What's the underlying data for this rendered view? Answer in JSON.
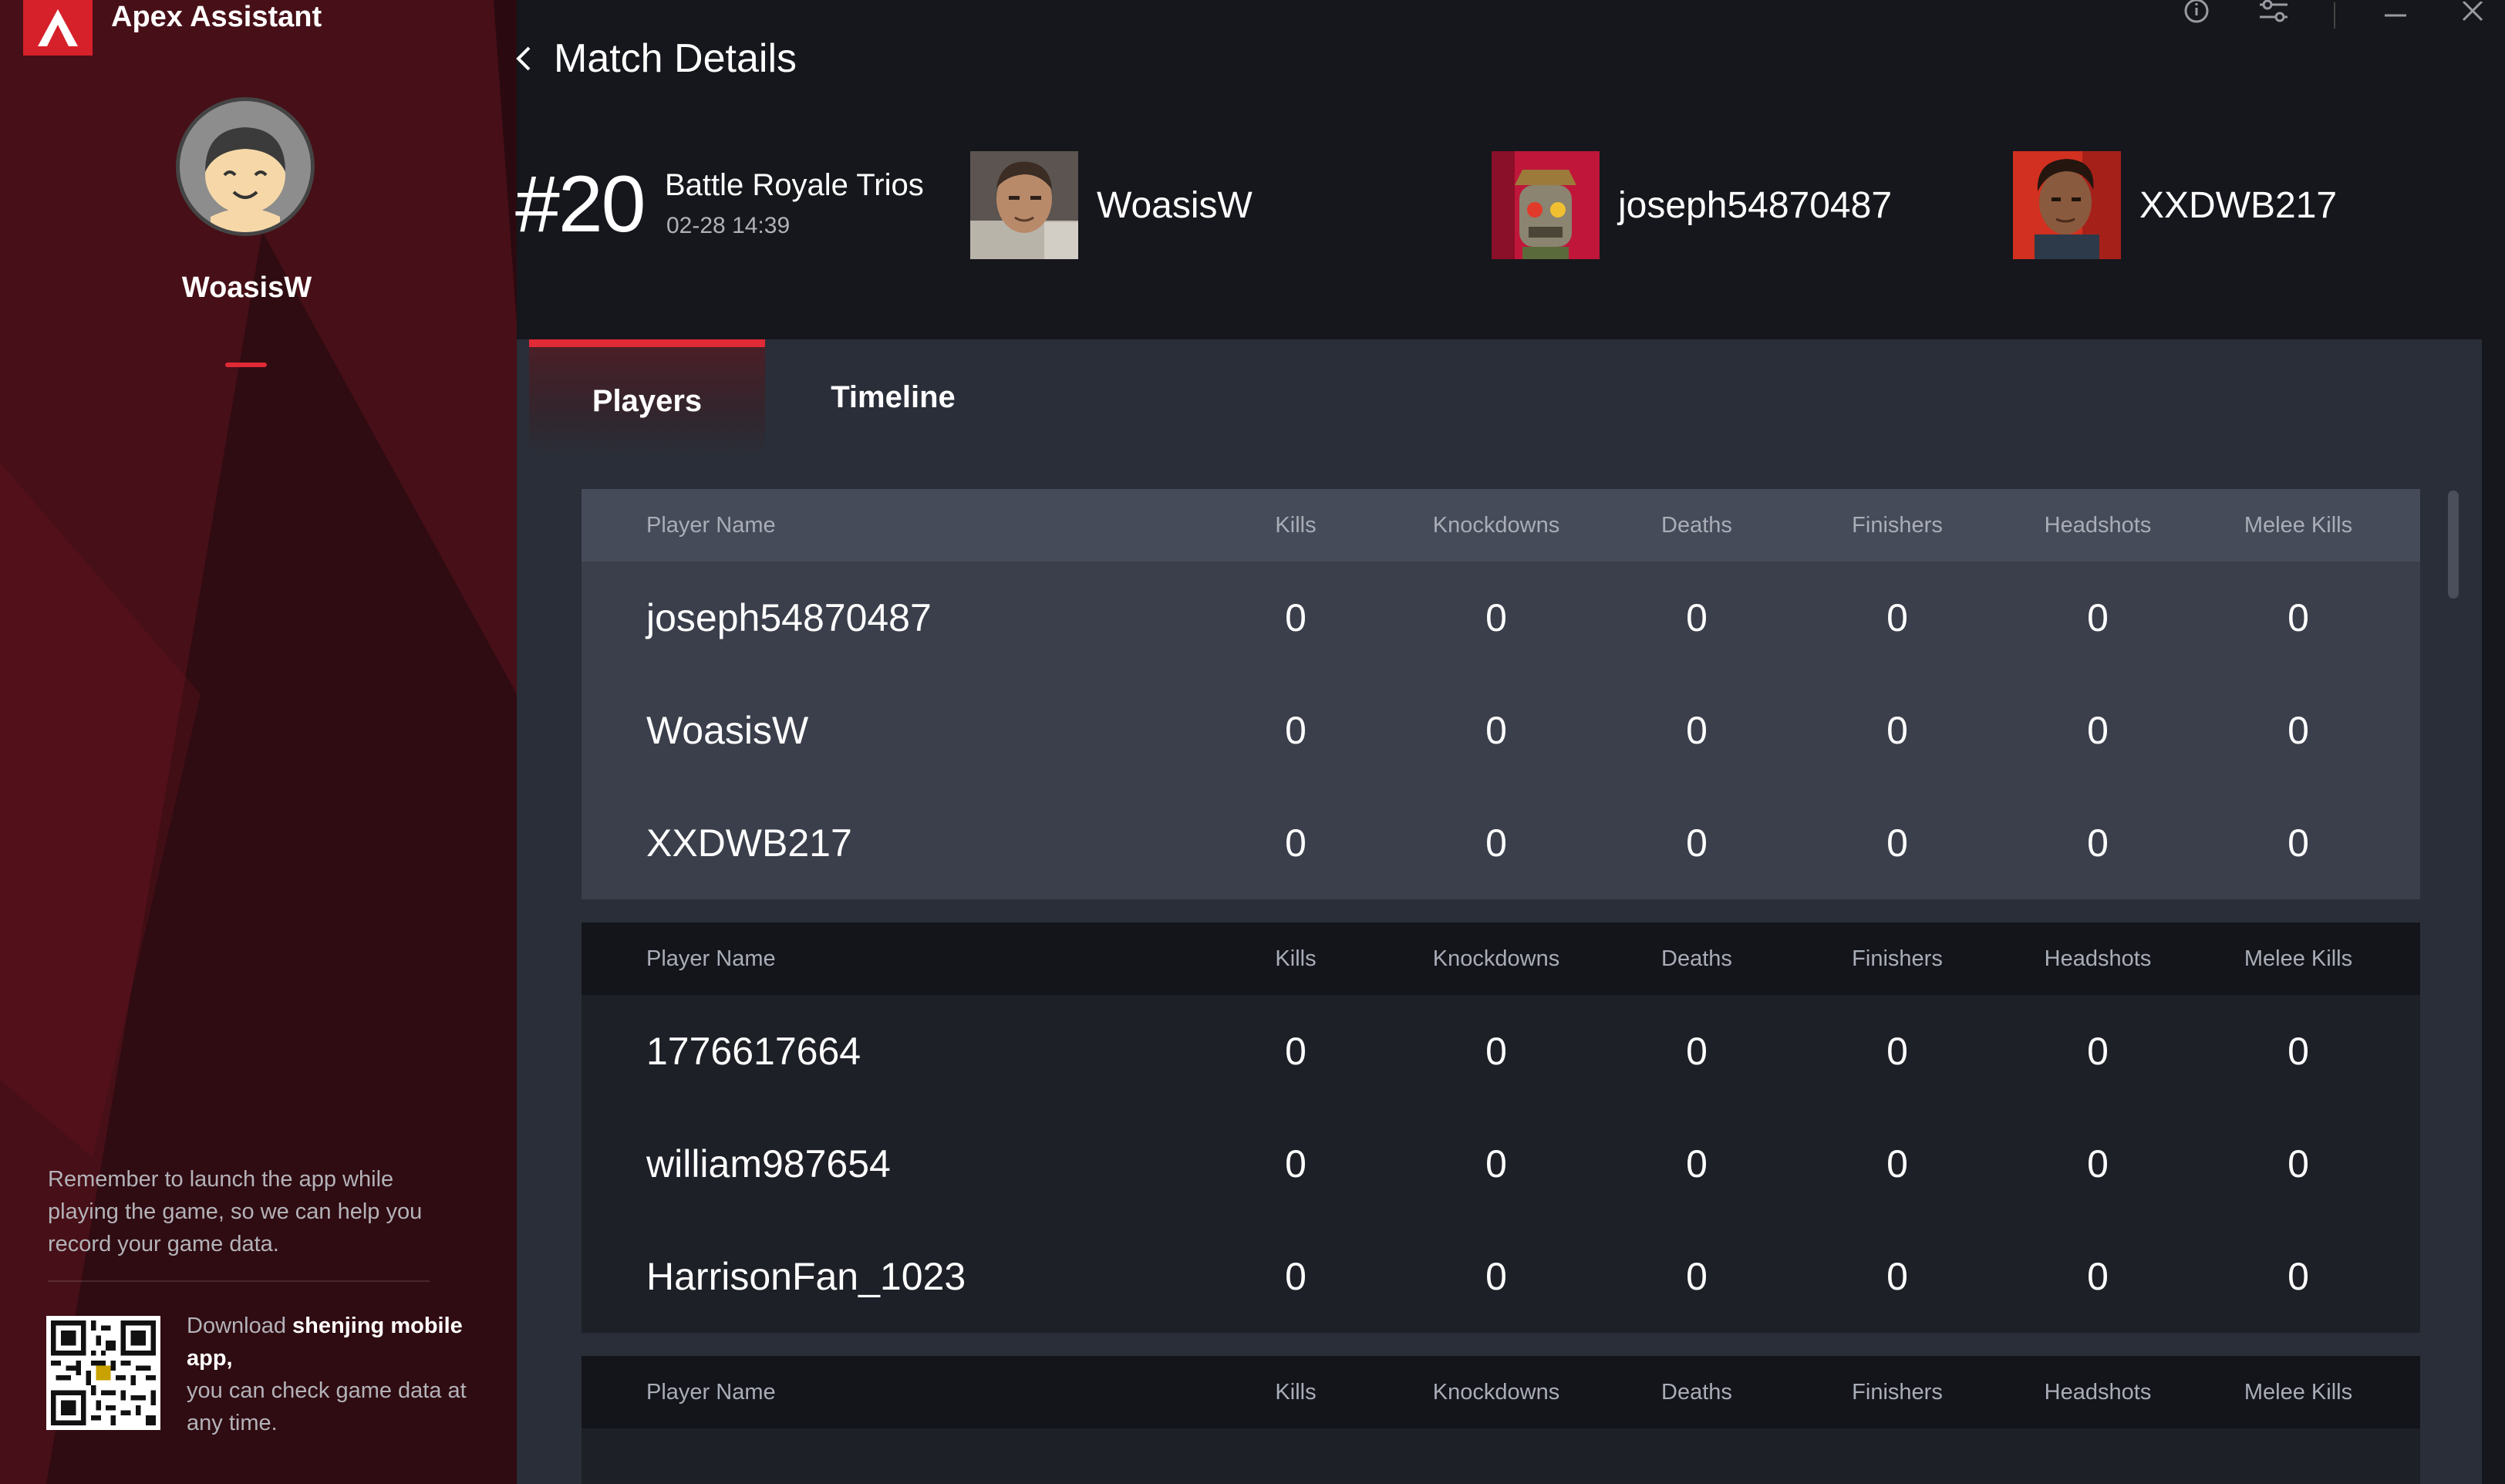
{
  "app": {
    "name": "Apex Assistant"
  },
  "user": {
    "name": "WoasisW"
  },
  "sidebar": {
    "tip": "Remember to launch the app while playing the game, so we can help you record your game data.",
    "download_prefix": "Download ",
    "download_app": "shenjing mobile app,",
    "download_suffix": "you can check game data at any time."
  },
  "header": {
    "title": "Match Details",
    "rank": "#20",
    "mode": "Battle Royale Trios",
    "time": "02-28 14:39"
  },
  "squad": [
    "WoasisW",
    "joseph54870487",
    "XXDWB217"
  ],
  "tabs": {
    "players": "Players",
    "timeline": "Timeline"
  },
  "columns": {
    "name": "Player Name",
    "kills": "Kills",
    "knockdowns": "Knockdowns",
    "deaths": "Deaths",
    "finishers": "Finishers",
    "headshots": "Headshots",
    "melee": "Melee Kills"
  },
  "teams": [
    {
      "players": [
        {
          "name": "joseph54870487",
          "kills": "0",
          "knockdowns": "0",
          "deaths": "0",
          "finishers": "0",
          "headshots": "0",
          "melee": "0"
        },
        {
          "name": "WoasisW",
          "kills": "0",
          "knockdowns": "0",
          "deaths": "0",
          "finishers": "0",
          "headshots": "0",
          "melee": "0"
        },
        {
          "name": "XXDWB217",
          "kills": "0",
          "knockdowns": "0",
          "deaths": "0",
          "finishers": "0",
          "headshots": "0",
          "melee": "0"
        }
      ]
    },
    {
      "players": [
        {
          "name": "1776617664",
          "kills": "0",
          "knockdowns": "0",
          "deaths": "0",
          "finishers": "0",
          "headshots": "0",
          "melee": "0"
        },
        {
          "name": "william987654",
          "kills": "0",
          "knockdowns": "0",
          "deaths": "0",
          "finishers": "0",
          "headshots": "0",
          "melee": "0"
        },
        {
          "name": "HarrisonFan_1023",
          "kills": "0",
          "knockdowns": "0",
          "deaths": "0",
          "finishers": "0",
          "headshots": "0",
          "melee": "0"
        }
      ]
    },
    {
      "players": []
    }
  ],
  "colors": {
    "accent": "#e02a36",
    "own_team_bg": "#3a3f4b",
    "other_team_bg": "#1e2028"
  }
}
